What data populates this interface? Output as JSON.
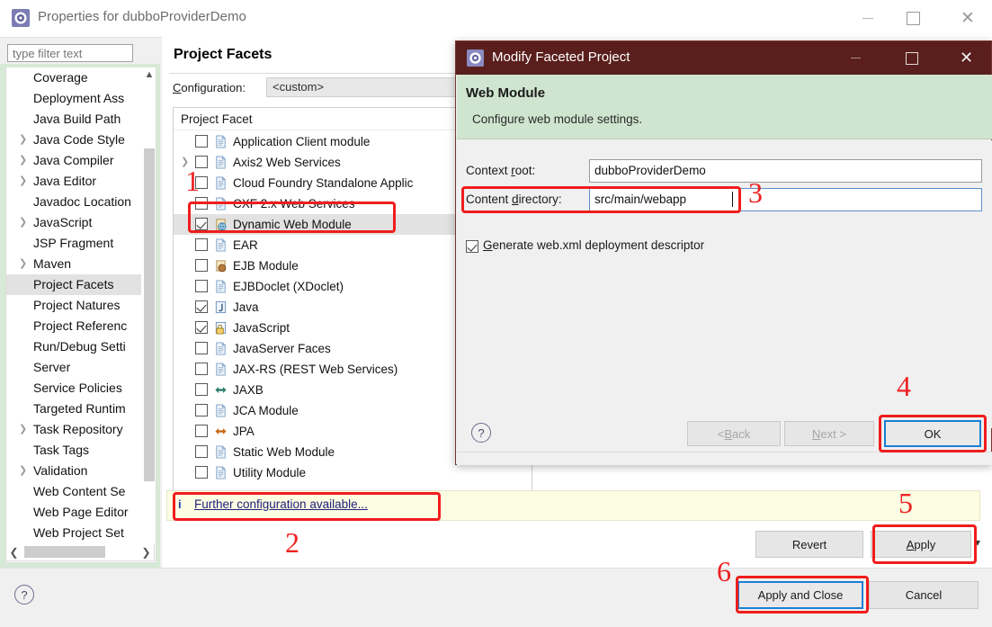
{
  "properties_window": {
    "title": "Properties for dubboProviderDemo",
    "title_icon": "eclipse-icon",
    "window_controls": {
      "minimize": "minimize-icon",
      "maximize": "maximize-icon",
      "close": "close-icon"
    },
    "filter": {
      "placeholder": "type filter text",
      "value": ""
    },
    "tree": {
      "items": [
        {
          "label": "Coverage",
          "expandable": false,
          "selected": false
        },
        {
          "label": "Deployment Ass",
          "expandable": false,
          "selected": false
        },
        {
          "label": "Java Build Path",
          "expandable": false,
          "selected": false
        },
        {
          "label": "Java Code Style",
          "expandable": true,
          "selected": false
        },
        {
          "label": "Java Compiler",
          "expandable": true,
          "selected": false
        },
        {
          "label": "Java Editor",
          "expandable": true,
          "selected": false
        },
        {
          "label": "Javadoc Location",
          "expandable": false,
          "selected": false
        },
        {
          "label": "JavaScript",
          "expandable": true,
          "selected": false
        },
        {
          "label": "JSP Fragment",
          "expandable": false,
          "selected": false
        },
        {
          "label": "Maven",
          "expandable": true,
          "selected": false
        },
        {
          "label": "Project Facets",
          "expandable": false,
          "selected": true
        },
        {
          "label": "Project Natures",
          "expandable": false,
          "selected": false
        },
        {
          "label": "Project Referenc",
          "expandable": false,
          "selected": false
        },
        {
          "label": "Run/Debug Setti",
          "expandable": false,
          "selected": false
        },
        {
          "label": "Server",
          "expandable": false,
          "selected": false
        },
        {
          "label": "Service Policies",
          "expandable": false,
          "selected": false
        },
        {
          "label": "Targeted Runtim",
          "expandable": false,
          "selected": false
        },
        {
          "label": "Task Repository",
          "expandable": true,
          "selected": false
        },
        {
          "label": "Task Tags",
          "expandable": false,
          "selected": false
        },
        {
          "label": "Validation",
          "expandable": true,
          "selected": false
        },
        {
          "label": "Web Content Se",
          "expandable": false,
          "selected": false
        },
        {
          "label": "Web Page Editor",
          "expandable": false,
          "selected": false
        },
        {
          "label": "Web Project Set",
          "expandable": false,
          "selected": false
        }
      ]
    },
    "page_title": "Project Facets",
    "configuration": {
      "label": "Configuration:",
      "accel": "C",
      "value": "<custom>"
    },
    "facet_table": {
      "column_header": "Project Facet",
      "rows": [
        {
          "label": "Application Client module",
          "checked": false,
          "expandable": false,
          "icon": "document-icon",
          "highlighted": false
        },
        {
          "label": "Axis2 Web Services",
          "checked": false,
          "expandable": true,
          "icon": "document-icon",
          "highlighted": false
        },
        {
          "label": "Cloud Foundry Standalone Applic",
          "checked": false,
          "expandable": false,
          "icon": "document-icon",
          "highlighted": false
        },
        {
          "label": "CXF 2.x Web Services",
          "checked": false,
          "expandable": false,
          "icon": "document-icon",
          "highlighted": false
        },
        {
          "label": "Dynamic Web Module",
          "checked": true,
          "expandable": false,
          "icon": "web-module-icon",
          "highlighted": true
        },
        {
          "label": "EAR",
          "checked": false,
          "expandable": false,
          "icon": "document-icon",
          "highlighted": false
        },
        {
          "label": "EJB Module",
          "checked": false,
          "expandable": false,
          "icon": "ejb-icon",
          "highlighted": false
        },
        {
          "label": "EJBDoclet (XDoclet)",
          "checked": false,
          "expandable": false,
          "icon": "document-icon",
          "highlighted": false
        },
        {
          "label": "Java",
          "checked": true,
          "expandable": false,
          "icon": "java-icon",
          "highlighted": false
        },
        {
          "label": "JavaScript",
          "checked": true,
          "expandable": false,
          "icon": "javascript-icon",
          "highlighted": false
        },
        {
          "label": "JavaServer Faces",
          "checked": false,
          "expandable": false,
          "icon": "document-icon",
          "highlighted": false
        },
        {
          "label": "JAX-RS (REST Web Services)",
          "checked": false,
          "expandable": false,
          "icon": "document-icon",
          "highlighted": false
        },
        {
          "label": "JAXB",
          "checked": false,
          "expandable": false,
          "icon": "jaxb-icon",
          "highlighted": false
        },
        {
          "label": "JCA Module",
          "checked": false,
          "expandable": false,
          "icon": "document-icon",
          "highlighted": false
        },
        {
          "label": "JPA",
          "checked": false,
          "expandable": false,
          "icon": "jpa-icon",
          "highlighted": false
        },
        {
          "label": "Static Web Module",
          "checked": false,
          "expandable": false,
          "icon": "document-icon",
          "highlighted": false
        },
        {
          "label": "Utility Module",
          "checked": false,
          "expandable": false,
          "icon": "document-icon",
          "highlighted": false
        }
      ]
    },
    "info_bar": {
      "icon": "info-icon",
      "link": "Further configuration available..."
    },
    "buttons": {
      "revert": "Revert",
      "apply": "Apply",
      "apply_accel": "A",
      "apply_and_close": "Apply and Close",
      "cancel": "Cancel",
      "help": "?"
    }
  },
  "dialog": {
    "title": "Modify Faceted Project",
    "title_icon": "eclipse-icon",
    "window_controls": {
      "minimize": "minimize-icon",
      "maximize": "maximize-icon",
      "close": "close-icon"
    },
    "header": {
      "title": "Web Module",
      "subtitle": "Configure web module settings."
    },
    "fields": {
      "context_root": {
        "label": "Context root:",
        "accel": "r",
        "value": "dubboProviderDemo"
      },
      "content_directory": {
        "label": "Content directory:",
        "accel": "d",
        "value": "src/main/webapp",
        "focused": true
      }
    },
    "checkbox": {
      "label": "Generate web.xml deployment descriptor",
      "accel": "G",
      "checked": true
    },
    "buttons": {
      "back": "< Back",
      "back_accel": "B",
      "next": "Next >",
      "next_accel": "N",
      "ok": "OK",
      "help": "?"
    }
  },
  "annotations": {
    "numbers": [
      "1",
      "2",
      "3",
      "4",
      "5",
      "6"
    ],
    "color": "#ee2222"
  }
}
